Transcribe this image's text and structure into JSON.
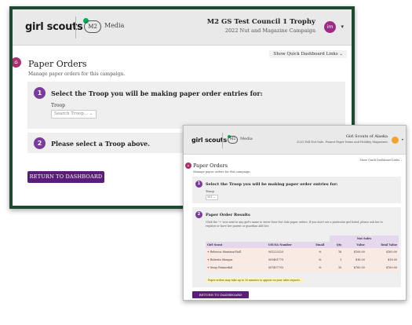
{
  "back": {
    "header": {
      "logo": "girl scouts",
      "m2_badge": "M2",
      "m2_label": "Media",
      "campaign_title": "M2 GS Test Council 1 Trophy",
      "campaign_sub": "2022 Nut and Magazine Campaign",
      "avatar": "im"
    },
    "quick_links": "Show Quick Dashboard Links ⌄",
    "page_title": "Paper Orders",
    "page_subtitle": "Manage paper orders for this campaign.",
    "step1": {
      "number": "1",
      "title": "Select the Troop you will be making paper order entries for:",
      "label": "Troop",
      "placeholder": "Search Troop... ⌄"
    },
    "step2": {
      "number": "2",
      "title": "Please select a Troop above."
    },
    "return_button": "RETURN TO DASHBOARD"
  },
  "front": {
    "header": {
      "logo": "girl scouts",
      "m2_badge": "M2",
      "m2_label": "Media",
      "campaign_title": "Girl Scouts of Alaska",
      "campaign_sub": "2022 Fall Nut Sale, Peanut Paper Items and Holiday Magazines"
    },
    "quick_links": "Show Quick Dashboard Links ⌄",
    "page_title": "Paper Orders",
    "page_subtitle": "Manage paper orders for this campaign.",
    "step1": {
      "number": "1",
      "title": "Select the Troop you will be making paper order entries for:",
      "label": "Troop",
      "value": "101 ⌄"
    },
    "step2": {
      "number": "2",
      "title": "Paper Order Results",
      "description": "Click the '+' icon next to any girl's name to enter their Nut Sale paper orders. If you don't see a particular girl listed, please ask her to register or have her parent or guardian add her.",
      "group_header": "Nut Sales",
      "columns": [
        "Girl Scout",
        "GSUSA Number",
        "Email",
        "Qty",
        "Value",
        "Total Value"
      ],
      "rows": [
        {
          "name": "Rebecca Montana-Violl",
          "gsusa": "001225320",
          "email": "✉",
          "qty": "16",
          "value": "$106.00",
          "total": "$160.00"
        },
        {
          "name": "Roberta Mongas",
          "gsusa": "001461779",
          "email": "✉",
          "qty": "1",
          "value": "$16.00",
          "total": "$16.00"
        },
        {
          "name": "Sway Primordial",
          "gsusa": "007457793",
          "email": "✉",
          "qty": "10",
          "value": "$760.00",
          "total": "$760.00"
        }
      ],
      "note": "Paper orders may take up to 30 minutes to appear on your sales reports."
    },
    "return_button": "RETURN TO DASHBOARD"
  },
  "colors": {
    "frame": "#1c4a32",
    "purple": "#5a1e7a",
    "step": "#7b3a9e",
    "gs_green": "#00ae58",
    "home": "#a8326e"
  }
}
